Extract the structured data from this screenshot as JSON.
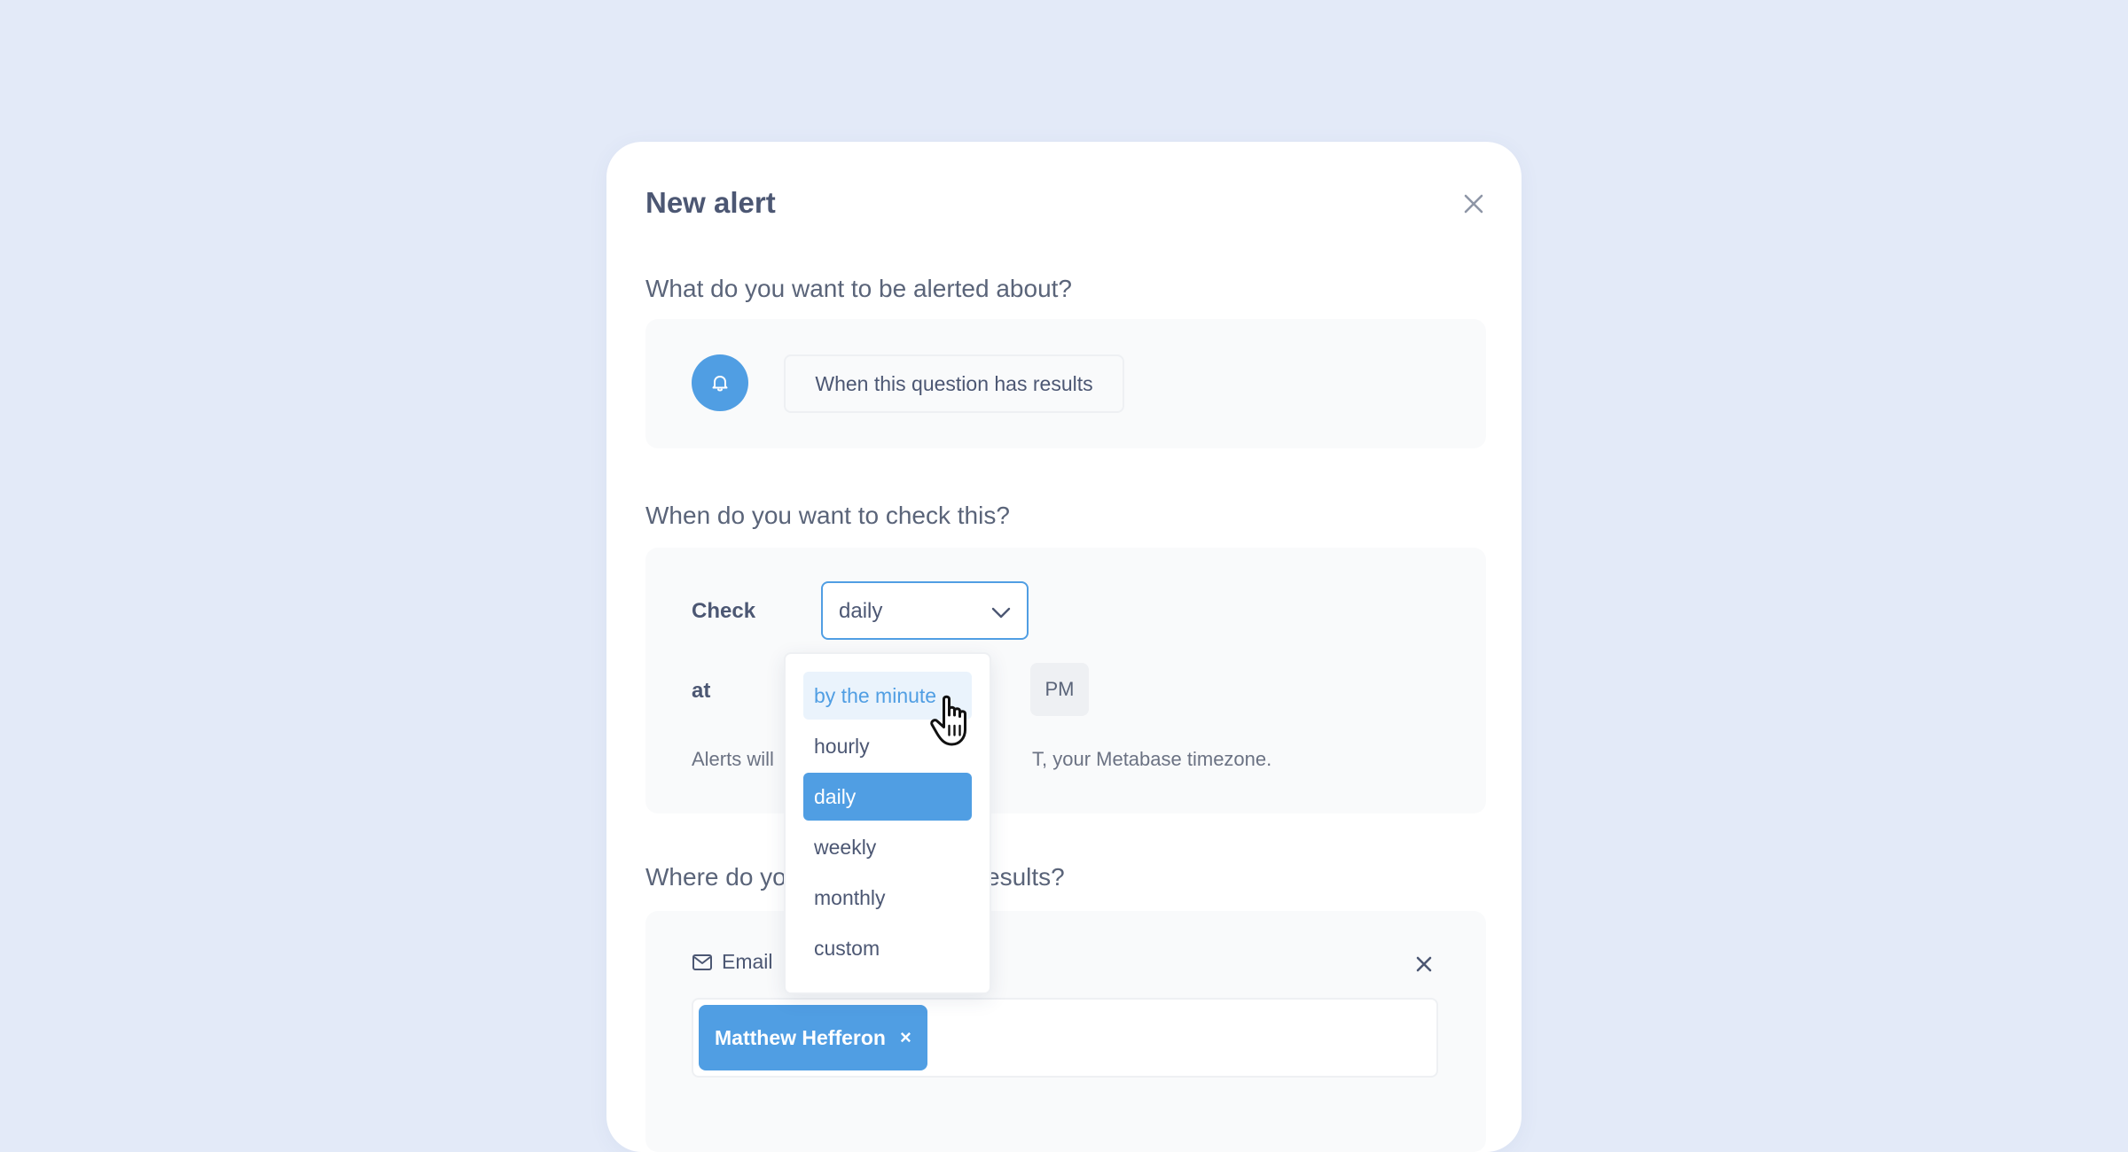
{
  "modal": {
    "title": "New alert"
  },
  "sections": {
    "what_question": "What do you want to be alerted about?",
    "when_question": "When do you want to check this?",
    "where_question_left": "Where do yo",
    "where_question_right": "esults?"
  },
  "alert_condition": {
    "icon": "bell-icon",
    "label": "When this question has results"
  },
  "schedule": {
    "check_label": "Check",
    "frequency_value": "daily",
    "at_label": "at",
    "ampm_label": "PM",
    "timezone_left": "Alerts will",
    "timezone_right": "T, your Metabase timezone."
  },
  "frequency_dropdown": {
    "options": [
      "by the minute",
      "hourly",
      "daily",
      "weekly",
      "monthly",
      "custom"
    ],
    "hovered": "by the minute",
    "selected": "daily"
  },
  "channel": {
    "icon": "mail-icon",
    "label": "Email",
    "recipients": [
      {
        "name": "Matthew Hefferon",
        "remove_label": "×"
      }
    ]
  },
  "colors": {
    "page_background": "#e3eaf8",
    "brand": "#509ee3",
    "text_dark": "#4c5773",
    "panel_background": "#f9fafb"
  }
}
